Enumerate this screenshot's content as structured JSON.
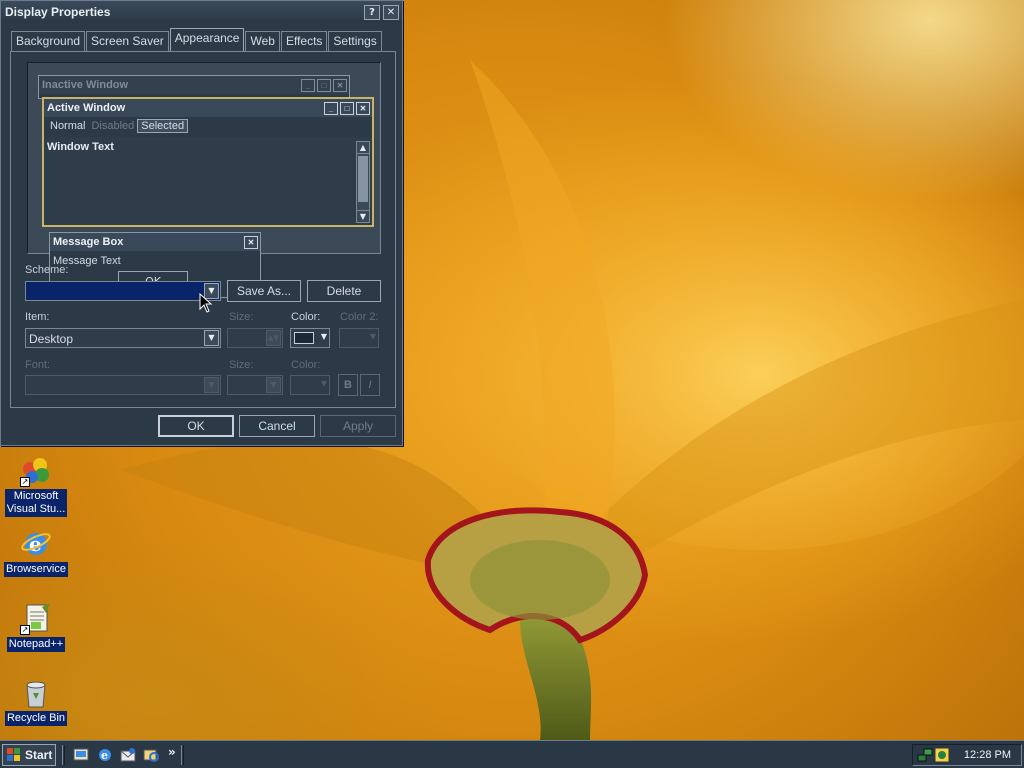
{
  "window": {
    "title": "Display Properties",
    "help_btn": "?",
    "close_btn": "✕"
  },
  "tabs": [
    "Background",
    "Screen Saver",
    "Appearance",
    "Web",
    "Effects",
    "Settings"
  ],
  "active_tab": "Appearance",
  "preview": {
    "inactive_title": "Inactive Window",
    "active_title": "Active Window",
    "menu_normal": "Normal",
    "menu_disabled": "Disabled",
    "menu_selected": "Selected",
    "window_text": "Window Text",
    "msgbox_title": "Message Box",
    "msgbox_text": "Message Text",
    "msgbox_ok": "OK"
  },
  "scheme": {
    "label": "Scheme:",
    "value": "",
    "save_as": "Save As...",
    "delete": "Delete"
  },
  "item": {
    "label": "Item:",
    "value": "Desktop",
    "size_label": "Size:",
    "color_label": "Color:",
    "color2_label": "Color 2:"
  },
  "font": {
    "label": "Font:",
    "size_label": "Size:",
    "color_label": "Color:",
    "bold": "B",
    "italic": "I"
  },
  "buttons": {
    "ok": "OK",
    "cancel": "Cancel",
    "apply": "Apply"
  },
  "desktop_icons": [
    {
      "label_line1": "Microsoft",
      "label_line2": "Visual Stu..."
    },
    {
      "label_line1": "Browservice"
    },
    {
      "label_line1": "Notepad++"
    },
    {
      "label_line1": "Recycle Bin"
    }
  ],
  "taskbar": {
    "start": "Start",
    "chevron": "»",
    "clock": "12:28 PM"
  },
  "colors": {
    "scheme_selected": "#0a246a",
    "window_bg": "#2c3a48",
    "active_border": "#c8b366"
  }
}
